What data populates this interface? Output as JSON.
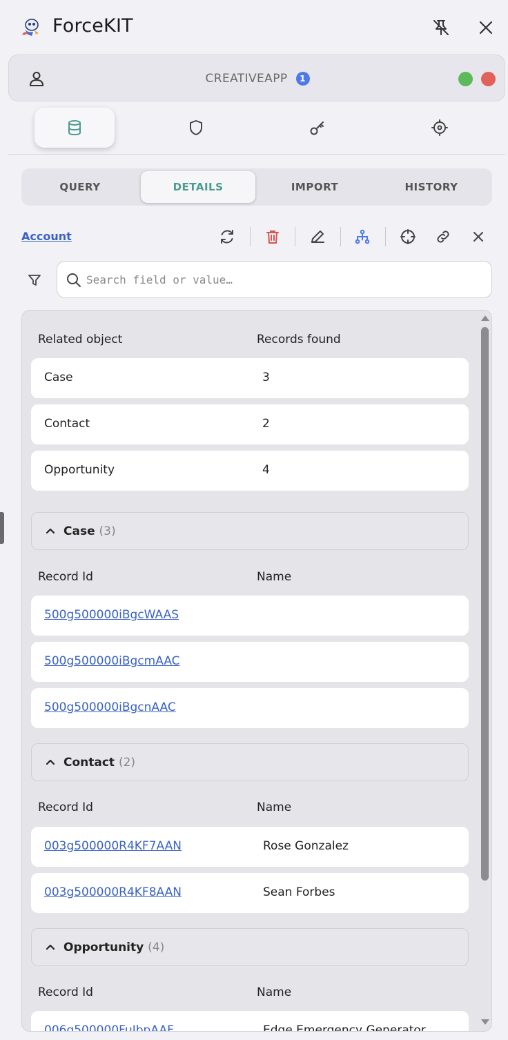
{
  "header": {
    "title": "ForceKIT",
    "logo_icon": "rocket-mascot-icon",
    "pin_icon": "unpin-icon",
    "close_icon": "close-icon"
  },
  "org": {
    "name": "CREATIVEAPP",
    "badge": "1",
    "status_colors": [
      "#5cba5a",
      "#e0625a"
    ]
  },
  "icon_tabs": [
    {
      "icon": "database-icon",
      "active": true
    },
    {
      "icon": "shield-icon",
      "active": false
    },
    {
      "icon": "key-icon",
      "active": false
    },
    {
      "icon": "settings-icon",
      "active": false
    }
  ],
  "sub_tabs": [
    {
      "label": "QUERY",
      "active": false
    },
    {
      "label": "DETAILS",
      "active": true
    },
    {
      "label": "IMPORT",
      "active": false
    },
    {
      "label": "HISTORY",
      "active": false
    }
  ],
  "toolbar": {
    "object": "Account",
    "tools": [
      "refresh-icon",
      "delete-icon",
      "edit-icon",
      "hierarchy-icon",
      "crosshair-icon",
      "link-icon",
      "close-icon"
    ]
  },
  "search": {
    "placeholder": "Search field or value…",
    "value": ""
  },
  "summary": {
    "columns": [
      "Related object",
      "Records found"
    ],
    "rows": [
      {
        "object": "Case",
        "count": "3"
      },
      {
        "object": "Contact",
        "count": "2"
      },
      {
        "object": "Opportunity",
        "count": "4"
      }
    ]
  },
  "sections": [
    {
      "title": "Case",
      "count": "(3)",
      "columns": [
        "Record Id",
        "Name"
      ],
      "rows": [
        {
          "id": "500g500000iBgcWAAS",
          "name": ""
        },
        {
          "id": "500g500000iBgcmAAC",
          "name": ""
        },
        {
          "id": "500g500000iBgcnAAC",
          "name": ""
        }
      ]
    },
    {
      "title": "Contact",
      "count": "(2)",
      "columns": [
        "Record Id",
        "Name"
      ],
      "rows": [
        {
          "id": "003g500000R4KF7AAN",
          "name": "Rose Gonzalez"
        },
        {
          "id": "003g500000R4KF8AAN",
          "name": "Sean Forbes"
        }
      ]
    },
    {
      "title": "Opportunity",
      "count": "(4)",
      "columns": [
        "Record Id",
        "Name"
      ],
      "rows": [
        {
          "id": "006g500000FuIbpAAF",
          "name": "Edge Emergency Generator"
        }
      ]
    }
  ]
}
